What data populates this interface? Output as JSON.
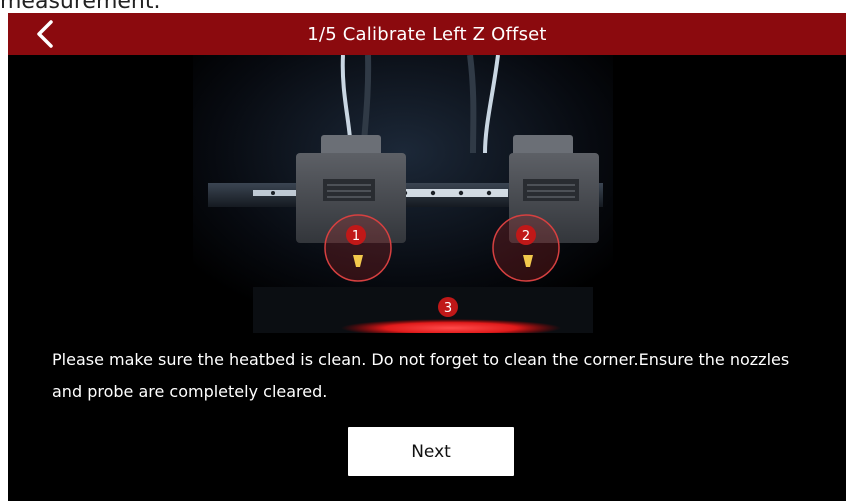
{
  "page": {
    "caption_above": "measurement."
  },
  "header": {
    "title": "1/5 Calibrate Left Z Offset",
    "back_icon": "chevron-left-icon"
  },
  "illustration": {
    "markers": [
      "1",
      "2",
      "3"
    ]
  },
  "message": {
    "text": "Please make sure the heatbed is clean. Do not forget to clean the corner.Ensure the nozzles and probe are completely cleared."
  },
  "actions": {
    "next_label": "Next"
  },
  "colors": {
    "header_bg": "#8b0a0e",
    "screen_bg": "#000000",
    "marker_red": "#c01818",
    "button_bg": "#ffffff"
  }
}
